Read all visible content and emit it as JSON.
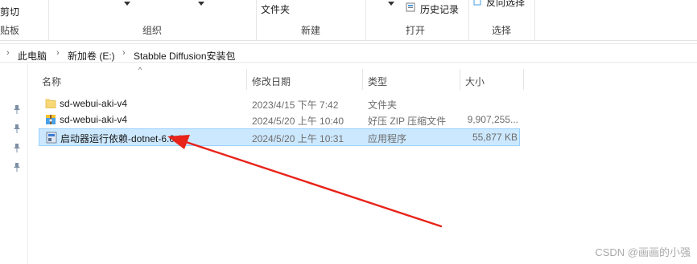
{
  "ribbon": {
    "cut_label": "剪切",
    "clipboard_group": "贴板",
    "organize_group": "组织",
    "new_group": "新建",
    "open_group": "打开",
    "select_group": "选择",
    "new_folder_label": "文件夹",
    "history_label": "历史记录",
    "invert_select_label": "反向选择"
  },
  "address": {
    "crumbs": [
      "此电脑",
      "新加卷 (E:)",
      "Stabble Diffusion安装包"
    ]
  },
  "columns": {
    "name": "名称",
    "modified": "修改日期",
    "type": "类型",
    "size": "大小"
  },
  "files": [
    {
      "name": "sd-webui-aki-v4",
      "modified": "2023/4/15 下午 7:42",
      "type": "文件夹",
      "size": "",
      "icon": "folder-icon",
      "selected": false
    },
    {
      "name": "sd-webui-aki-v4",
      "modified": "2024/5/20 上午 10:40",
      "type": "好压 ZIP 压缩文件",
      "size": "9,907,255...",
      "icon": "zip-archive-icon",
      "selected": false
    },
    {
      "name": "启动器运行依赖-dotnet-6.0.11",
      "modified": "2024/5/20 上午 10:31",
      "type": "应用程序",
      "size": "55,877 KB",
      "icon": "installer-app-icon",
      "selected": true
    }
  ],
  "colors": {
    "selection_bg": "#cce8ff",
    "selection_border": "#99d1ff",
    "arrow": "#e8231a",
    "folder": "#f8d775"
  },
  "watermark": "CSDN @画画的小强"
}
